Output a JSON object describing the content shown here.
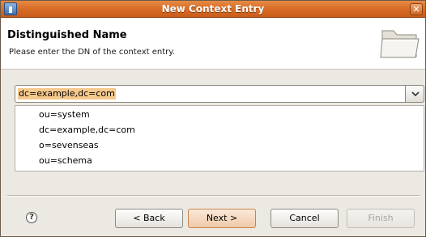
{
  "window": {
    "title": "New Context Entry",
    "close_glyph": "✕"
  },
  "header": {
    "title": "Distinguished Name",
    "description": "Please enter the DN of the context entry.",
    "icon": "folder-icon"
  },
  "dn_combo": {
    "value": "dc=example,dc=com",
    "button_icon": "chevron-down-icon"
  },
  "dn_list": {
    "items": [
      "ou=system",
      "dc=example,dc=com",
      "o=sevenseas",
      "ou=schema"
    ]
  },
  "footer": {
    "help_glyph": "?",
    "back_label": "< Back",
    "next_label": "Next >",
    "cancel_label": "Cancel",
    "finish_label": "Finish"
  },
  "colors": {
    "titlebar": "#d66a24",
    "selection": "#f5c98c",
    "primary_button": "#f0c9a9"
  }
}
